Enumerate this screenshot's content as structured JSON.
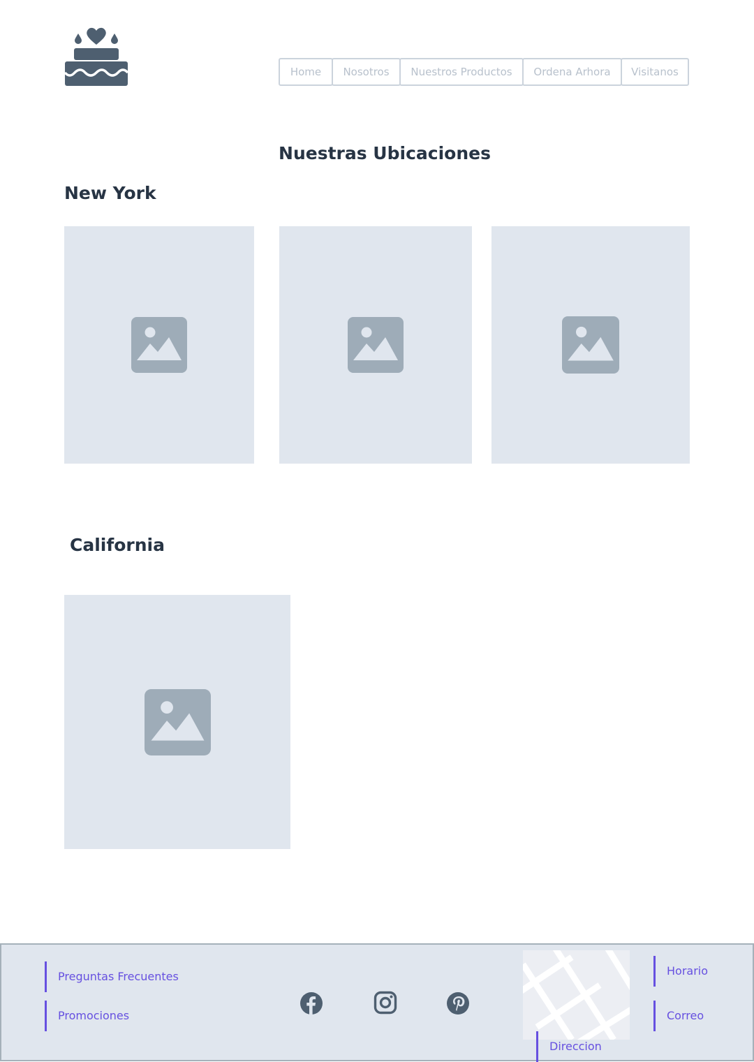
{
  "logo": {
    "icon": "cake-icon",
    "color": "#4e5f70"
  },
  "nav": {
    "items": [
      "Home",
      "Nosotros",
      "Nuestros Productos",
      "Ordena Arhora",
      "Visitanos"
    ]
  },
  "main": {
    "title": "Nuestras Ubicaciones",
    "sections": [
      {
        "heading": "New York",
        "images": [
          "image-placeholder-icon",
          "image-placeholder-icon",
          "image-placeholder-icon"
        ]
      },
      {
        "heading": "California",
        "images": [
          "image-placeholder-icon"
        ]
      }
    ]
  },
  "footer": {
    "links_left": [
      "Preguntas Frecuentes",
      "Promociones"
    ],
    "social": [
      "facebook-icon",
      "instagram-icon",
      "pinterest-icon"
    ],
    "map": "map-icon",
    "links_right": [
      "Horario",
      "Correo"
    ],
    "address_label": "Direccion"
  },
  "colors": {
    "accent": "#6650e0",
    "placeholder_bg": "#e0e6ee",
    "placeholder_icon": "#9eacb8",
    "heading": "#273444",
    "icon_dark": "#4e5f70"
  }
}
